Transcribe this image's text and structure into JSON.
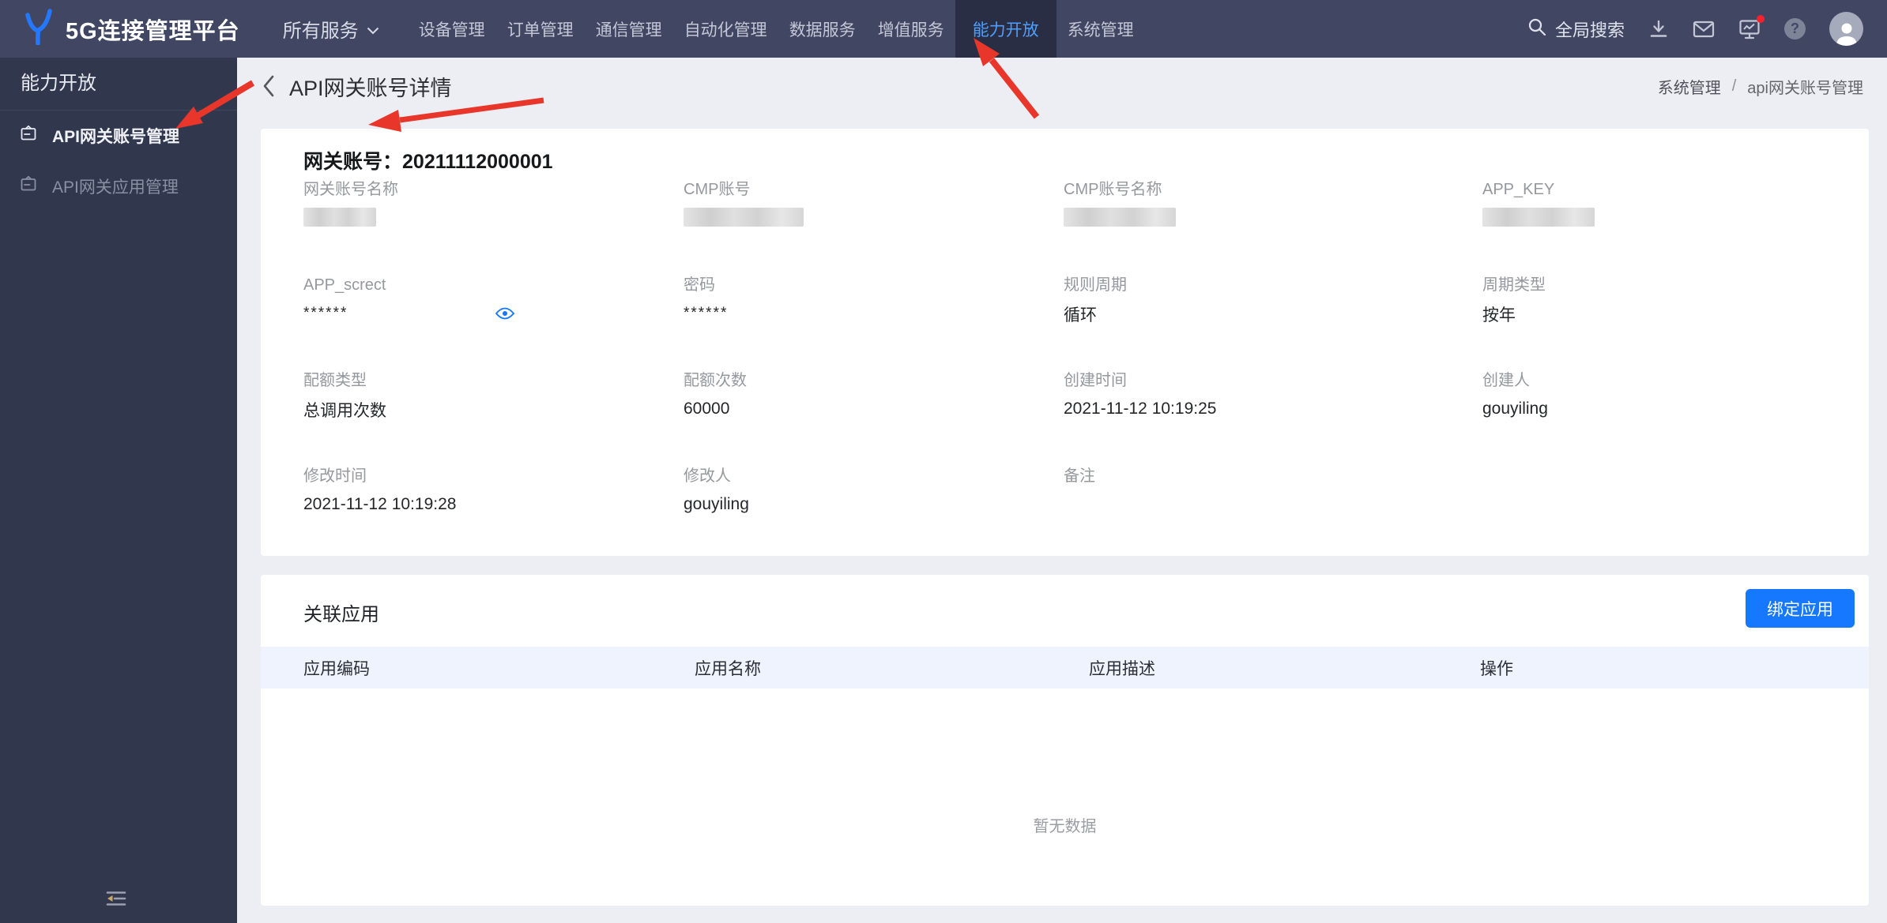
{
  "topbar": {
    "logo_text": "5G连接管理平台",
    "nav": [
      {
        "label": "所有服务"
      },
      {
        "label": "设备管理"
      },
      {
        "label": "订单管理"
      },
      {
        "label": "通信管理"
      },
      {
        "label": "自动化管理"
      },
      {
        "label": "数据服务"
      },
      {
        "label": "增值服务"
      },
      {
        "label": "能力开放"
      },
      {
        "label": "系统管理"
      }
    ],
    "search_label": "全局搜索",
    "help_glyph": "?"
  },
  "sidebar": {
    "title": "能力开放",
    "items": [
      {
        "label": "API网关账号管理"
      },
      {
        "label": "API网关应用管理"
      }
    ]
  },
  "page_header": {
    "title": "API网关账号详情",
    "breadcrumb_parent": "系统管理",
    "breadcrumb_sep": "/",
    "breadcrumb_current": "api网关账号管理"
  },
  "detail": {
    "title_label": "网关账号：",
    "title_value": "20211112000001",
    "fields": [
      {
        "label": "网关账号名称",
        "value": ""
      },
      {
        "label": "CMP账号",
        "value": ""
      },
      {
        "label": "CMP账号名称",
        "value": ""
      },
      {
        "label": "APP_KEY",
        "value": ""
      },
      {
        "label": "APP_screct",
        "value": "******"
      },
      {
        "label": "密码",
        "value": "******"
      },
      {
        "label": "规则周期",
        "value": "循环"
      },
      {
        "label": "周期类型",
        "value": "按年"
      },
      {
        "label": "配额类型",
        "value": "总调用次数"
      },
      {
        "label": "配额次数",
        "value": "60000"
      },
      {
        "label": "创建时间",
        "value": "2021-11-12 10:19:25"
      },
      {
        "label": "创建人",
        "value": "gouyiling"
      },
      {
        "label": "修改时间",
        "value": "2021-11-12 10:19:28"
      },
      {
        "label": "修改人",
        "value": "gouyiling"
      },
      {
        "label": "备注",
        "value": ""
      }
    ]
  },
  "related_apps": {
    "title": "关联应用",
    "bind_button_label": "绑定应用",
    "columns": [
      "应用编码",
      "应用名称",
      "应用描述",
      "操作"
    ],
    "empty_text": "暂无数据"
  },
  "colors": {
    "topbar_bg": "#414763",
    "sidebar_bg": "#31374d",
    "active_nav_text": "#4d9fff",
    "accent_blue": "#1677ff",
    "table_header_bg": "#eef3fd",
    "annotation_red": "#e8362b",
    "notification_dot": "#f5222d"
  }
}
